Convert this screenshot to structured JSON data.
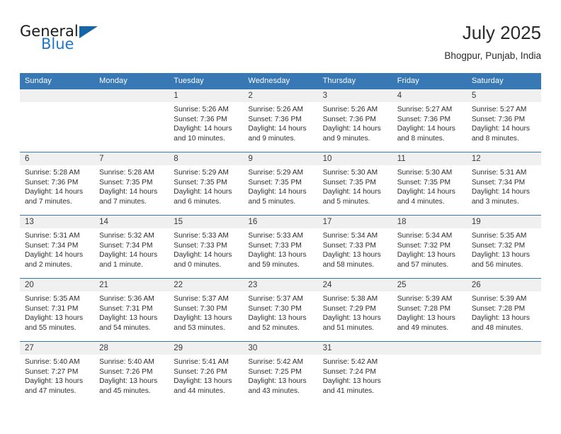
{
  "brand": {
    "name_part1": "General",
    "name_part2": "Blue",
    "triangle_color": "#1565a8",
    "blue_color": "#1f77c4"
  },
  "header": {
    "title": "July 2025",
    "subtitle": "Bhogpur, Punjab, India"
  },
  "theme": {
    "header_blue": "#3878b4",
    "daynum_bg": "#f0f0f0",
    "text": "#2e2e2e"
  },
  "weekday_headers": [
    "Sunday",
    "Monday",
    "Tuesday",
    "Wednesday",
    "Thursday",
    "Friday",
    "Saturday"
  ],
  "weeks": [
    [
      {
        "day": "",
        "empty": true,
        "lines": []
      },
      {
        "day": "",
        "empty": true,
        "lines": []
      },
      {
        "day": "1",
        "lines": [
          "Sunrise: 5:26 AM",
          "Sunset: 7:36 PM",
          "Daylight: 14 hours",
          "and 10 minutes."
        ]
      },
      {
        "day": "2",
        "lines": [
          "Sunrise: 5:26 AM",
          "Sunset: 7:36 PM",
          "Daylight: 14 hours",
          "and 9 minutes."
        ]
      },
      {
        "day": "3",
        "lines": [
          "Sunrise: 5:26 AM",
          "Sunset: 7:36 PM",
          "Daylight: 14 hours",
          "and 9 minutes."
        ]
      },
      {
        "day": "4",
        "lines": [
          "Sunrise: 5:27 AM",
          "Sunset: 7:36 PM",
          "Daylight: 14 hours",
          "and 8 minutes."
        ]
      },
      {
        "day": "5",
        "lines": [
          "Sunrise: 5:27 AM",
          "Sunset: 7:36 PM",
          "Daylight: 14 hours",
          "and 8 minutes."
        ]
      }
    ],
    [
      {
        "day": "6",
        "lines": [
          "Sunrise: 5:28 AM",
          "Sunset: 7:36 PM",
          "Daylight: 14 hours",
          "and 7 minutes."
        ]
      },
      {
        "day": "7",
        "lines": [
          "Sunrise: 5:28 AM",
          "Sunset: 7:35 PM",
          "Daylight: 14 hours",
          "and 7 minutes."
        ]
      },
      {
        "day": "8",
        "lines": [
          "Sunrise: 5:29 AM",
          "Sunset: 7:35 PM",
          "Daylight: 14 hours",
          "and 6 minutes."
        ]
      },
      {
        "day": "9",
        "lines": [
          "Sunrise: 5:29 AM",
          "Sunset: 7:35 PM",
          "Daylight: 14 hours",
          "and 5 minutes."
        ]
      },
      {
        "day": "10",
        "lines": [
          "Sunrise: 5:30 AM",
          "Sunset: 7:35 PM",
          "Daylight: 14 hours",
          "and 5 minutes."
        ]
      },
      {
        "day": "11",
        "lines": [
          "Sunrise: 5:30 AM",
          "Sunset: 7:35 PM",
          "Daylight: 14 hours",
          "and 4 minutes."
        ]
      },
      {
        "day": "12",
        "lines": [
          "Sunrise: 5:31 AM",
          "Sunset: 7:34 PM",
          "Daylight: 14 hours",
          "and 3 minutes."
        ]
      }
    ],
    [
      {
        "day": "13",
        "lines": [
          "Sunrise: 5:31 AM",
          "Sunset: 7:34 PM",
          "Daylight: 14 hours",
          "and 2 minutes."
        ]
      },
      {
        "day": "14",
        "lines": [
          "Sunrise: 5:32 AM",
          "Sunset: 7:34 PM",
          "Daylight: 14 hours",
          "and 1 minute."
        ]
      },
      {
        "day": "15",
        "lines": [
          "Sunrise: 5:33 AM",
          "Sunset: 7:33 PM",
          "Daylight: 14 hours",
          "and 0 minutes."
        ]
      },
      {
        "day": "16",
        "lines": [
          "Sunrise: 5:33 AM",
          "Sunset: 7:33 PM",
          "Daylight: 13 hours",
          "and 59 minutes."
        ]
      },
      {
        "day": "17",
        "lines": [
          "Sunrise: 5:34 AM",
          "Sunset: 7:33 PM",
          "Daylight: 13 hours",
          "and 58 minutes."
        ]
      },
      {
        "day": "18",
        "lines": [
          "Sunrise: 5:34 AM",
          "Sunset: 7:32 PM",
          "Daylight: 13 hours",
          "and 57 minutes."
        ]
      },
      {
        "day": "19",
        "lines": [
          "Sunrise: 5:35 AM",
          "Sunset: 7:32 PM",
          "Daylight: 13 hours",
          "and 56 minutes."
        ]
      }
    ],
    [
      {
        "day": "20",
        "lines": [
          "Sunrise: 5:35 AM",
          "Sunset: 7:31 PM",
          "Daylight: 13 hours",
          "and 55 minutes."
        ]
      },
      {
        "day": "21",
        "lines": [
          "Sunrise: 5:36 AM",
          "Sunset: 7:31 PM",
          "Daylight: 13 hours",
          "and 54 minutes."
        ]
      },
      {
        "day": "22",
        "lines": [
          "Sunrise: 5:37 AM",
          "Sunset: 7:30 PM",
          "Daylight: 13 hours",
          "and 53 minutes."
        ]
      },
      {
        "day": "23",
        "lines": [
          "Sunrise: 5:37 AM",
          "Sunset: 7:30 PM",
          "Daylight: 13 hours",
          "and 52 minutes."
        ]
      },
      {
        "day": "24",
        "lines": [
          "Sunrise: 5:38 AM",
          "Sunset: 7:29 PM",
          "Daylight: 13 hours",
          "and 51 minutes."
        ]
      },
      {
        "day": "25",
        "lines": [
          "Sunrise: 5:39 AM",
          "Sunset: 7:28 PM",
          "Daylight: 13 hours",
          "and 49 minutes."
        ]
      },
      {
        "day": "26",
        "lines": [
          "Sunrise: 5:39 AM",
          "Sunset: 7:28 PM",
          "Daylight: 13 hours",
          "and 48 minutes."
        ]
      }
    ],
    [
      {
        "day": "27",
        "lines": [
          "Sunrise: 5:40 AM",
          "Sunset: 7:27 PM",
          "Daylight: 13 hours",
          "and 47 minutes."
        ]
      },
      {
        "day": "28",
        "lines": [
          "Sunrise: 5:40 AM",
          "Sunset: 7:26 PM",
          "Daylight: 13 hours",
          "and 45 minutes."
        ]
      },
      {
        "day": "29",
        "lines": [
          "Sunrise: 5:41 AM",
          "Sunset: 7:26 PM",
          "Daylight: 13 hours",
          "and 44 minutes."
        ]
      },
      {
        "day": "30",
        "lines": [
          "Sunrise: 5:42 AM",
          "Sunset: 7:25 PM",
          "Daylight: 13 hours",
          "and 43 minutes."
        ]
      },
      {
        "day": "31",
        "lines": [
          "Sunrise: 5:42 AM",
          "Sunset: 7:24 PM",
          "Daylight: 13 hours",
          "and 41 minutes."
        ]
      },
      {
        "day": "",
        "empty": true,
        "lines": []
      },
      {
        "day": "",
        "empty": true,
        "lines": []
      }
    ]
  ]
}
